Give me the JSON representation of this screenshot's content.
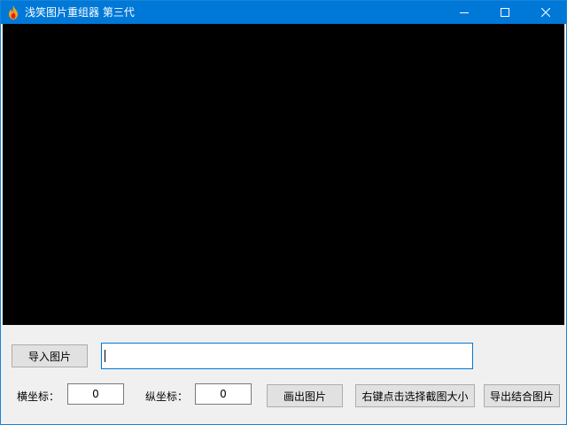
{
  "window": {
    "title": "浅笑图片重组器 第三代",
    "app_icon": "flame-icon",
    "controls": {
      "minimize": "minimize-icon",
      "maximize": "maximize-icon",
      "close": "close-icon"
    }
  },
  "toolbar": {
    "import_label": "导入图片",
    "path_value": "",
    "x_label": "横坐标：",
    "x_value": "0",
    "y_label": "纵坐标：",
    "y_value": "0",
    "draw_label": "画出图片",
    "select_label": "右键点击选择截图大小",
    "export_label": "导出结合图片"
  },
  "colors": {
    "titlebar": "#0078d7",
    "canvas": "#000000",
    "window_bg": "#f0f0f0"
  }
}
